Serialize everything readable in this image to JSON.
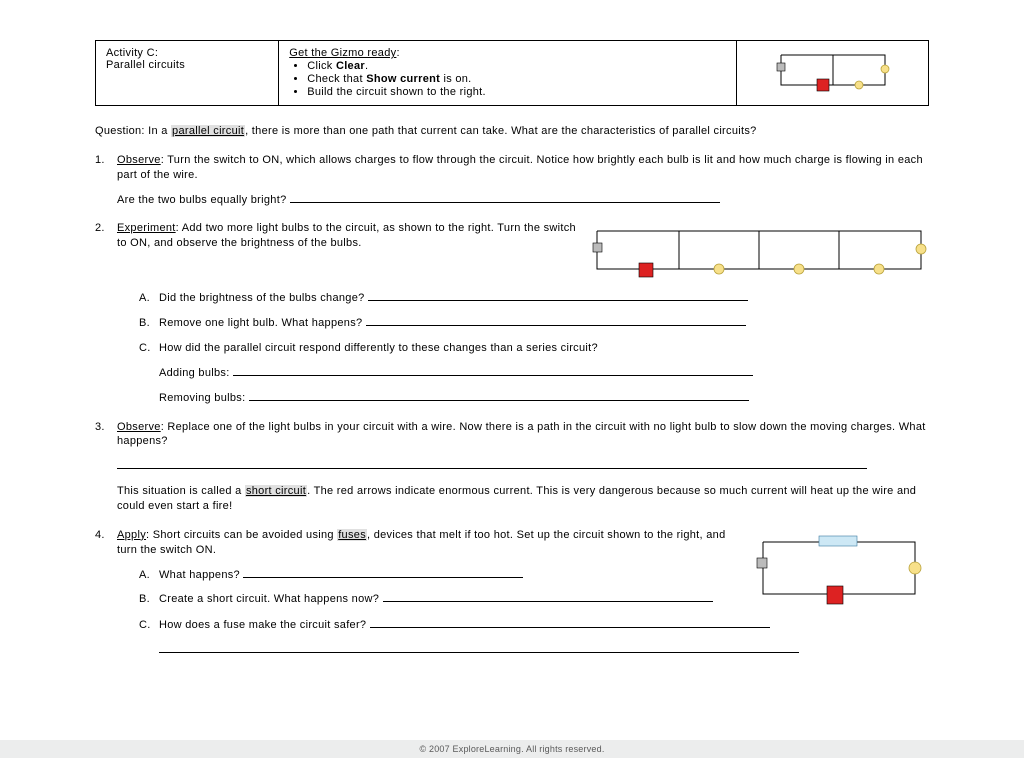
{
  "header": {
    "activity_label": "Activity C:",
    "activity_name": "Parallel circuits",
    "gizmo_heading": "Get the Gizmo ready",
    "gizmo_colon": ":",
    "steps": [
      "Click Clear.",
      "Check that Show current is on.",
      "Build the circuit shown to the right."
    ]
  },
  "question": {
    "lead": "Question: In a ",
    "term": "parallel circuit",
    "rest": ", there is more than one path that current can take. What are the characteristics of parallel circuits?"
  },
  "q1": {
    "num": "1.",
    "label": "Observe",
    "text": ": Turn the switch to ON, which allows charges to flow through the circuit. Notice how brightly each bulb is lit and how much charge is flowing in each part of the wire.",
    "prompt": "Are the two bulbs equally bright? "
  },
  "q2": {
    "num": "2.",
    "label": "Experiment",
    "text": ": Add two more light bulbs to the circuit, as shown to the right. Turn the switch to ON, and observe the brightness of the bulbs.",
    "a": {
      "lt": "A.",
      "text": "Did the brightness of the bulbs change? "
    },
    "b": {
      "lt": "B.",
      "text": "Remove one light bulb. What happens? "
    },
    "c": {
      "lt": "C.",
      "text": "How did the parallel circuit respond differently to these changes than a series circuit?",
      "adding": "Adding bulbs: ",
      "removing": "Removing bulbs: "
    }
  },
  "q3": {
    "num": "3.",
    "label": "Observe",
    "text": ": Replace one of the light bulbs in your circuit with a wire. Now there is a path in the circuit with no light bulb to slow down the moving charges. What happens?",
    "explain1": "This situation is called a ",
    "term": "short circuit",
    "explain2": ". The red arrows indicate enormous current. This is very dangerous because so much current will heat up the wire and could even start a fire!"
  },
  "q4": {
    "num": "4.",
    "label": "Apply",
    "text1": ": Short circuits can be avoided using ",
    "term": "fuses",
    "text2": ", devices that melt if too hot. Set up the circuit shown to the right, and turn the switch ON.",
    "a": {
      "lt": "A.",
      "text": "What happens? "
    },
    "b": {
      "lt": "B.",
      "text": "Create a short circuit. What happens now? "
    },
    "c": {
      "lt": "C.",
      "text": "How does a fuse make the circuit safer? "
    }
  },
  "footer": "© 2007 ExploreLearning. All rights reserved."
}
